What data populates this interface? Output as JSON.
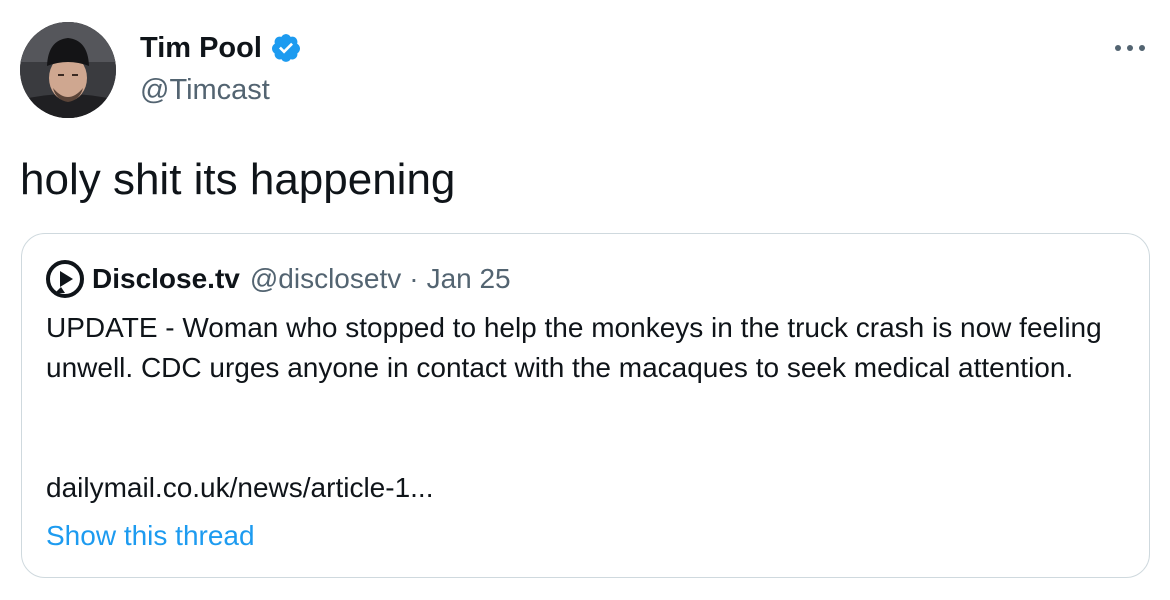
{
  "author": {
    "name": "Tim Pool",
    "handle": "@Timcast",
    "avatar_icon": "profile-photo",
    "verified": true,
    "verified_color": "#1d9bf0"
  },
  "tweet": {
    "text": "holy shit its happening",
    "more_icon": "ellipsis-icon"
  },
  "quoted_tweet": {
    "account_icon": "disclose-tv-logo",
    "name": "Disclose.tv",
    "handle": "@disclosetv",
    "separator": "·",
    "date": "Jan 25",
    "body": "UPDATE - Woman who stopped to help the monkeys in the truck crash is now feeling unwell. CDC urges anyone in contact with the macaques to seek medical attention.",
    "link": "dailymail.co.uk/news/article-1...",
    "show_thread": "Show this thread"
  },
  "colors": {
    "text": "#0f1419",
    "secondary_text": "#536471",
    "link": "#1d9bf0",
    "border": "#cfd9de"
  }
}
